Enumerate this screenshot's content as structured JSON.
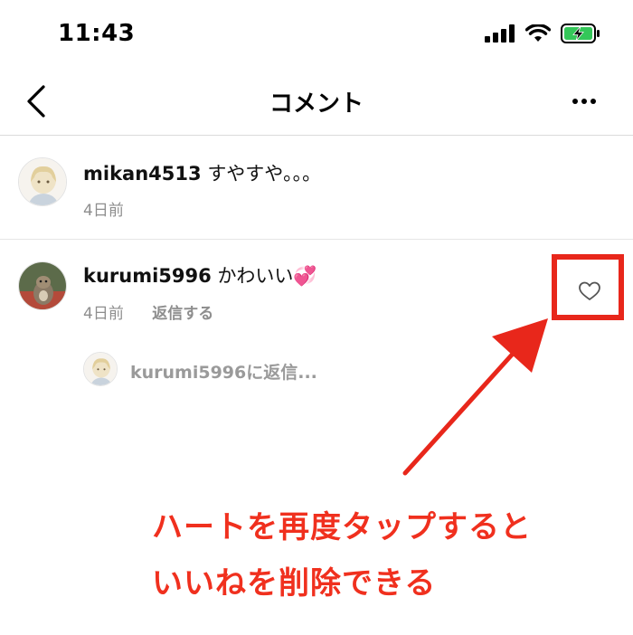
{
  "status_bar": {
    "time": "11:43",
    "icons": [
      "signal-icon",
      "wifi-icon",
      "battery-charging-icon"
    ],
    "battery_color": "#34c759"
  },
  "nav": {
    "title": "コメント",
    "back_icon": "chevron-left-icon",
    "more_icon": "more-horizontal-icon"
  },
  "comments": [
    {
      "username": "mikan4513",
      "text": "すやすや。。。",
      "time": "4日前"
    },
    {
      "username": "kurumi5996",
      "text": "かわいい💞",
      "time": "4日前",
      "reply_label": "返信する",
      "liked": false
    }
  ],
  "reply_box": {
    "placeholder": "kurumi5996に返信..."
  },
  "annotation": {
    "line1": "ハートを再度タップすると",
    "line2": "いいねを削除できる",
    "color": "#e8271b"
  }
}
